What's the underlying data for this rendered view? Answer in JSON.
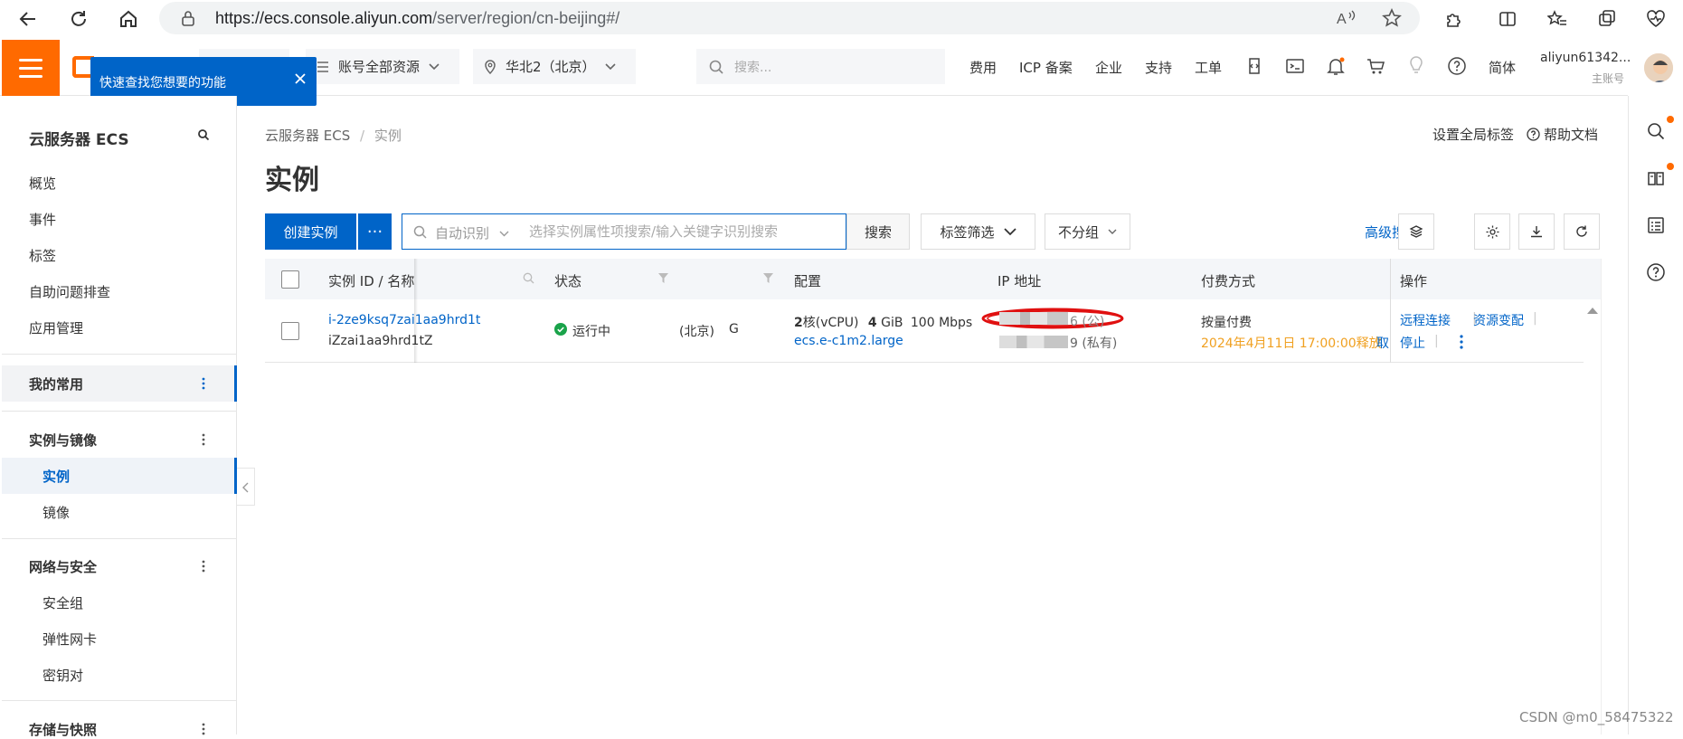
{
  "browser": {
    "url_host": "https://ecs.console.aliyun.com",
    "url_path": "/server/region/cn-beijing#/"
  },
  "header": {
    "resource_scope": "账号全部资源",
    "region": "华北2（北京）",
    "search_placeholder": "搜索...",
    "links": [
      "费用",
      "ICP 备案",
      "企业",
      "支持",
      "工单"
    ],
    "language": "简体",
    "account_name": "aliyun61342...",
    "account_role": "主账号",
    "brand_color": "#ff6a00"
  },
  "tooltip": {
    "text": "快速查找您想要的功能"
  },
  "sidebar": {
    "title": "云服务器 ECS",
    "top_items": [
      "概览",
      "事件",
      "标签",
      "自助问题排查",
      "应用管理"
    ],
    "favorites": "我的常用",
    "group_instances": "实例与镜像",
    "instances_items": [
      "实例",
      "镜像"
    ],
    "group_network": "网络与安全",
    "network_items": [
      "安全组",
      "弹性网卡",
      "密钥对"
    ],
    "group_storage": "存储与快照"
  },
  "main": {
    "breadcrumb_root": "云服务器 ECS",
    "breadcrumb_sep": "/",
    "breadcrumb_current": "实例",
    "global_tags": "设置全局标签",
    "help_docs": "帮助文档",
    "title": "实例",
    "create_label": "创建实例",
    "more_label": "···",
    "search_mode": "自动识别",
    "search_placeholder": "选择实例属性项搜索/输入关键字识别搜索",
    "search_label": "搜索",
    "tag_filter": "标签筛选",
    "grouping": "不分组",
    "advanced_search": "高级搜索",
    "accent_color": "#0064c8"
  },
  "table": {
    "headers": {
      "id_name": "实例 ID / 名称",
      "status": "状态",
      "config": "配置",
      "ip": "IP 地址",
      "billing": "付费方式",
      "actions": "操作"
    },
    "rows": [
      {
        "id": "i-2ze9ksq7zai1aa9hrd1t",
        "name": "iZzai1aa9hrd1tZ",
        "status": "运行中",
        "zone_partial": "(北京)",
        "zone_tail": "G",
        "cpu_num": "2",
        "cpu_unit": "核(vCPU)",
        "mem_num": "4",
        "mem_unit": "GiB",
        "bandwidth": "100 Mbps",
        "instance_type": "ecs.e-c1m2.large",
        "public_ip_suffix": "6 (公)",
        "private_ip_suffix": "9 (私有)",
        "billing_type": "按量付费",
        "release_time": "2024年4月11日 17:00:00释放",
        "release_tail": "取",
        "action_remote": "远程连接",
        "action_resize": "资源变配",
        "action_stop": "停止"
      }
    ]
  },
  "watermark": "CSDN @m0_58475322"
}
